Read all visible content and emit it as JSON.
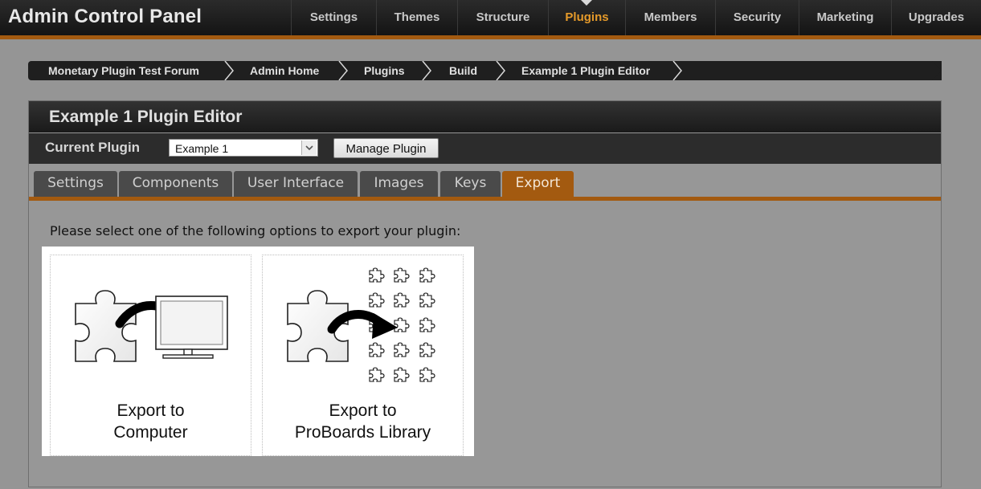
{
  "app": {
    "title": "Admin Control Panel"
  },
  "topnav": {
    "items": [
      {
        "label": "Settings",
        "active": false
      },
      {
        "label": "Themes",
        "active": false
      },
      {
        "label": "Structure",
        "active": false
      },
      {
        "label": "Plugins",
        "active": true
      },
      {
        "label": "Members",
        "active": false
      },
      {
        "label": "Security",
        "active": false
      },
      {
        "label": "Marketing",
        "active": false
      },
      {
        "label": "Upgrades",
        "active": false
      }
    ]
  },
  "breadcrumb": {
    "items": [
      {
        "label": "Monetary Plugin Test Forum"
      },
      {
        "label": "Admin Home"
      },
      {
        "label": "Plugins"
      },
      {
        "label": "Build"
      },
      {
        "label": "Example 1 Plugin Editor"
      }
    ]
  },
  "editor": {
    "title": "Example 1 Plugin Editor",
    "current_plugin_label": "Current Plugin",
    "selected_plugin": "Example 1",
    "manage_button": "Manage Plugin",
    "tabs": [
      {
        "label": "Settings",
        "active": false
      },
      {
        "label": "Components",
        "active": false
      },
      {
        "label": "User Interface",
        "active": false
      },
      {
        "label": "Images",
        "active": false
      },
      {
        "label": "Keys",
        "active": false
      },
      {
        "label": "Export",
        "active": true
      }
    ],
    "instructions": "Please select one of the following options to export your plugin:",
    "options": [
      {
        "line1": "Export to",
        "line2": "Computer",
        "icon": "export-to-computer-icon"
      },
      {
        "line1": "Export to",
        "line2": "ProBoards Library",
        "icon": "export-to-library-icon"
      }
    ]
  },
  "colors": {
    "accent": "#a35a10",
    "active_nav_text": "#e59a2a",
    "page_background": "#959595"
  }
}
